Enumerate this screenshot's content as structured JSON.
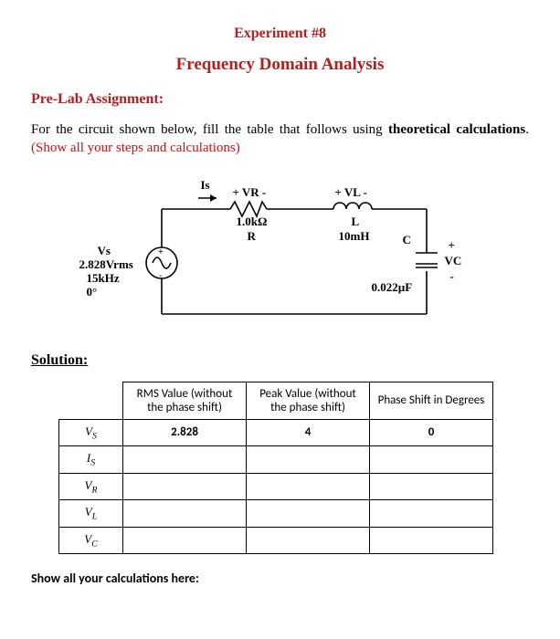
{
  "header": {
    "exp_title": "Experiment #8",
    "main_title": "Frequency Domain Analysis"
  },
  "prelab": {
    "heading": "Pre-Lab Assignment:",
    "para_p1": "For the circuit shown below, fill the table that follows using ",
    "para_bold": "theoretical calculations",
    "para_p2": ". ",
    "para_red": "(Show all your steps and calculations)"
  },
  "circuit": {
    "Is": "Is",
    "VR_label": "+  VR  -",
    "VL_label": "+  VL  -",
    "R_val": "1.0kΩ",
    "R_sym": "R",
    "L_sym": "L",
    "L_val": "10mH",
    "src_name": "Vs",
    "src_rms": "2.828Vrms",
    "src_freq": "15kHz",
    "src_phase": "0°",
    "C_sym": "C",
    "C_val": "0.022µF",
    "VC_plus": "+",
    "VC_label": "VC",
    "VC_minus": "-"
  },
  "solution": {
    "heading": "Solution:",
    "cols": {
      "rms": "RMS Value (without the phase shift)",
      "peak": "Peak Value (without the phase shift)",
      "phase": "Phase Shift in Degrees"
    },
    "rows": [
      {
        "var": "V",
        "sub": "S",
        "rms": "2.828",
        "peak": "4",
        "phase": "0"
      },
      {
        "var": "I",
        "sub": "S",
        "rms": "",
        "peak": "",
        "phase": ""
      },
      {
        "var": "V",
        "sub": "R",
        "rms": "",
        "peak": "",
        "phase": ""
      },
      {
        "var": "V",
        "sub": "L",
        "rms": "",
        "peak": "",
        "phase": ""
      },
      {
        "var": "V",
        "sub": "C",
        "rms": "",
        "peak": "",
        "phase": ""
      }
    ]
  },
  "footer": "Show all your calculations here:"
}
